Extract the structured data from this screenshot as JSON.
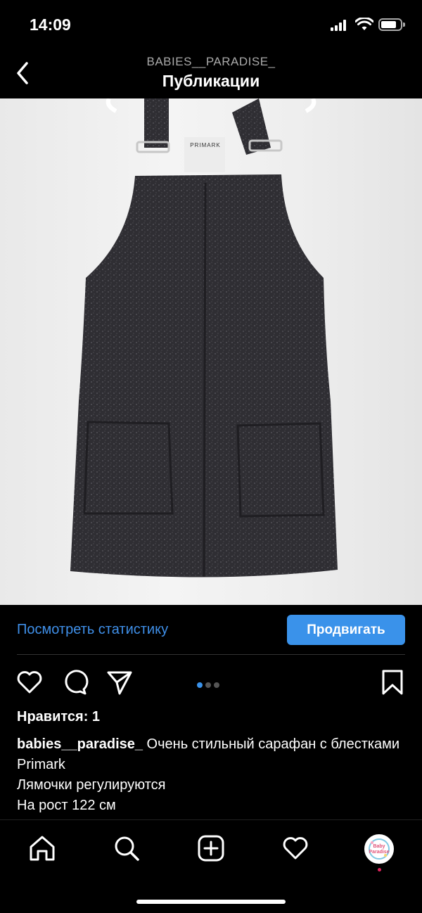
{
  "status": {
    "time": "14:09"
  },
  "nav": {
    "username": "BABIES__PARADISE_",
    "title": "Публикации"
  },
  "photo": {
    "label_brand": "PRIMARK"
  },
  "stats": {
    "link": "Посмотреть статистику",
    "promote": "Продвигать"
  },
  "likes": "Нравится: 1",
  "caption": {
    "user": "babies__paradise_",
    "text": " Очень стильный сарафан с блестками Primark",
    "line2": "Лямочки регулируются",
    "line3": "На рост 122 см"
  },
  "avatar": {
    "text": "Baby Paradise"
  },
  "colors": {
    "accent": "#3a92ea",
    "link": "#3f8fe8",
    "background": "#000000"
  }
}
